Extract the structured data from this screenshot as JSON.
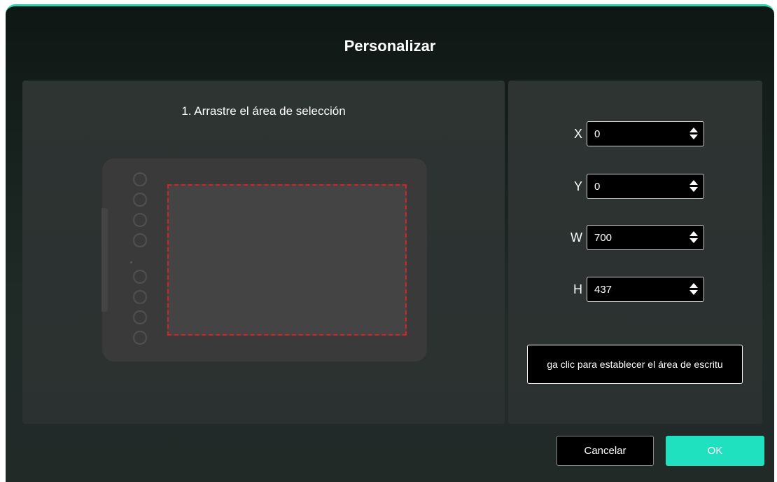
{
  "dialog": {
    "title": "Personalizar"
  },
  "left_panel": {
    "instruction": "1. Arrastre el área de selección"
  },
  "fields": [
    {
      "label": "X",
      "value": "0"
    },
    {
      "label": "Y",
      "value": "0"
    },
    {
      "label": "W",
      "value": "700"
    },
    {
      "label": "H",
      "value": "437"
    }
  ],
  "set_area_button": {
    "label": "ga clic para establecer el área de escritu"
  },
  "footer": {
    "cancel_label": "Cancelar",
    "ok_label": "OK"
  },
  "icons": {
    "spinner": "up-down-spinner-icon",
    "express_keys": "express-key-icon"
  },
  "colors": {
    "accent": "#1fe0bf",
    "selection_border": "#e02020",
    "dialog_bg": "#1f2a27",
    "panel_bg": "#2d3432"
  }
}
